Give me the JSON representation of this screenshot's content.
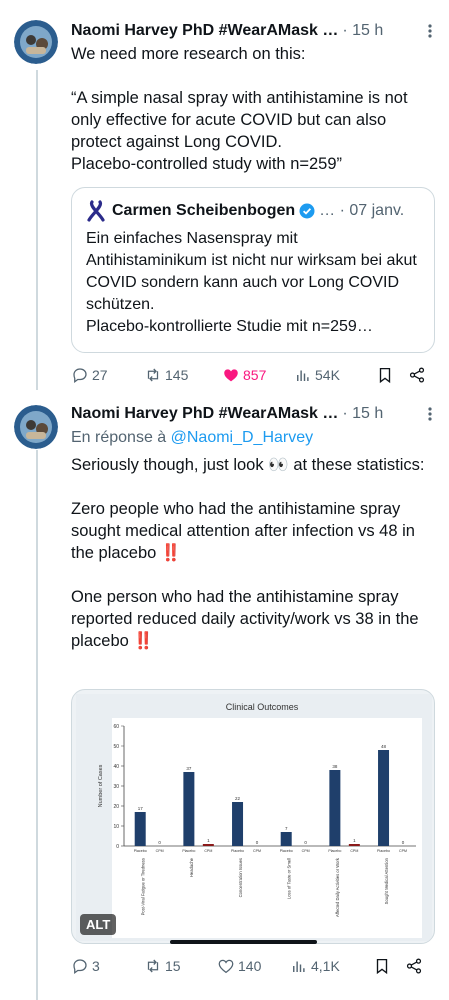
{
  "thread": [
    {
      "author": "Naomi Harvey PhD #WearAMask …",
      "time": "· 15 h",
      "paragraphs": [
        "We need more research on this:",
        "“A simple nasal spray with antihistamine is not only effective for acute COVID but can also protect against Long COVID.\nPlacebo-controlled study with n=259”"
      ],
      "quote": {
        "author": "Carmen Scheibenbogen",
        "time": "… · 07 janv.",
        "text": "Ein einfaches Nasenspray mit Antihistaminikum ist nicht nur wirksam bei akut COVID sondern kann auch vor Long COVID schützen.\nPlacebo-kontrollierte Studie mit n=259…"
      },
      "actions": {
        "replies": "27",
        "retweets": "145",
        "likes": "857",
        "views": "54K"
      }
    },
    {
      "author": "Naomi Harvey PhD #WearAMask …",
      "time": "· 15 h",
      "reply_prefix": "En réponse à ",
      "reply_to": "@Naomi_D_Harvey",
      "paragraphs": [
        "Seriously though, just look 👀 at these statistics:",
        "Zero people who had the antihistamine spray sought medical attention after infection vs 48 in the placebo ‼️",
        "One person who had the antihistamine spray reported reduced daily activity/work vs 38 in the placebo ‼️"
      ],
      "image_alt_badge": "ALT",
      "actions": {
        "replies": "3",
        "retweets": "15",
        "likes": "140",
        "views": "4,1K"
      }
    }
  ],
  "chart_data": {
    "type": "bar",
    "title": "Clinical Outcomes",
    "ylabel": "Number of Cases",
    "ylim": [
      0,
      60
    ],
    "yticks": [
      0,
      10,
      20,
      30,
      40,
      50,
      60
    ],
    "categories": [
      "Post-Viral Fatigue or Tiredness",
      "Headache",
      "Concentration Issues",
      "Loss of Taste or Smell",
      "Affected Daily Activities or Work",
      "Sought Medical Attention"
    ],
    "group_labels": [
      "Placebo",
      "CPM"
    ],
    "series": [
      {
        "name": "Placebo",
        "values": [
          17,
          37,
          22,
          7,
          38,
          48
        ]
      },
      {
        "name": "CPM",
        "values": [
          0,
          1,
          0,
          0,
          1,
          0
        ]
      }
    ],
    "bar_labels": [
      "17",
      "37",
      "22",
      "7",
      "38",
      "48"
    ],
    "colors": {
      "placebo": "#1f3f6b",
      "cpm": "#8b1a1a",
      "panel_bg": "#ffffff"
    }
  },
  "colors": {
    "like": "#f91880",
    "muted": "#536471",
    "link": "#1d9bf0",
    "verified": "#1d9bf0"
  }
}
